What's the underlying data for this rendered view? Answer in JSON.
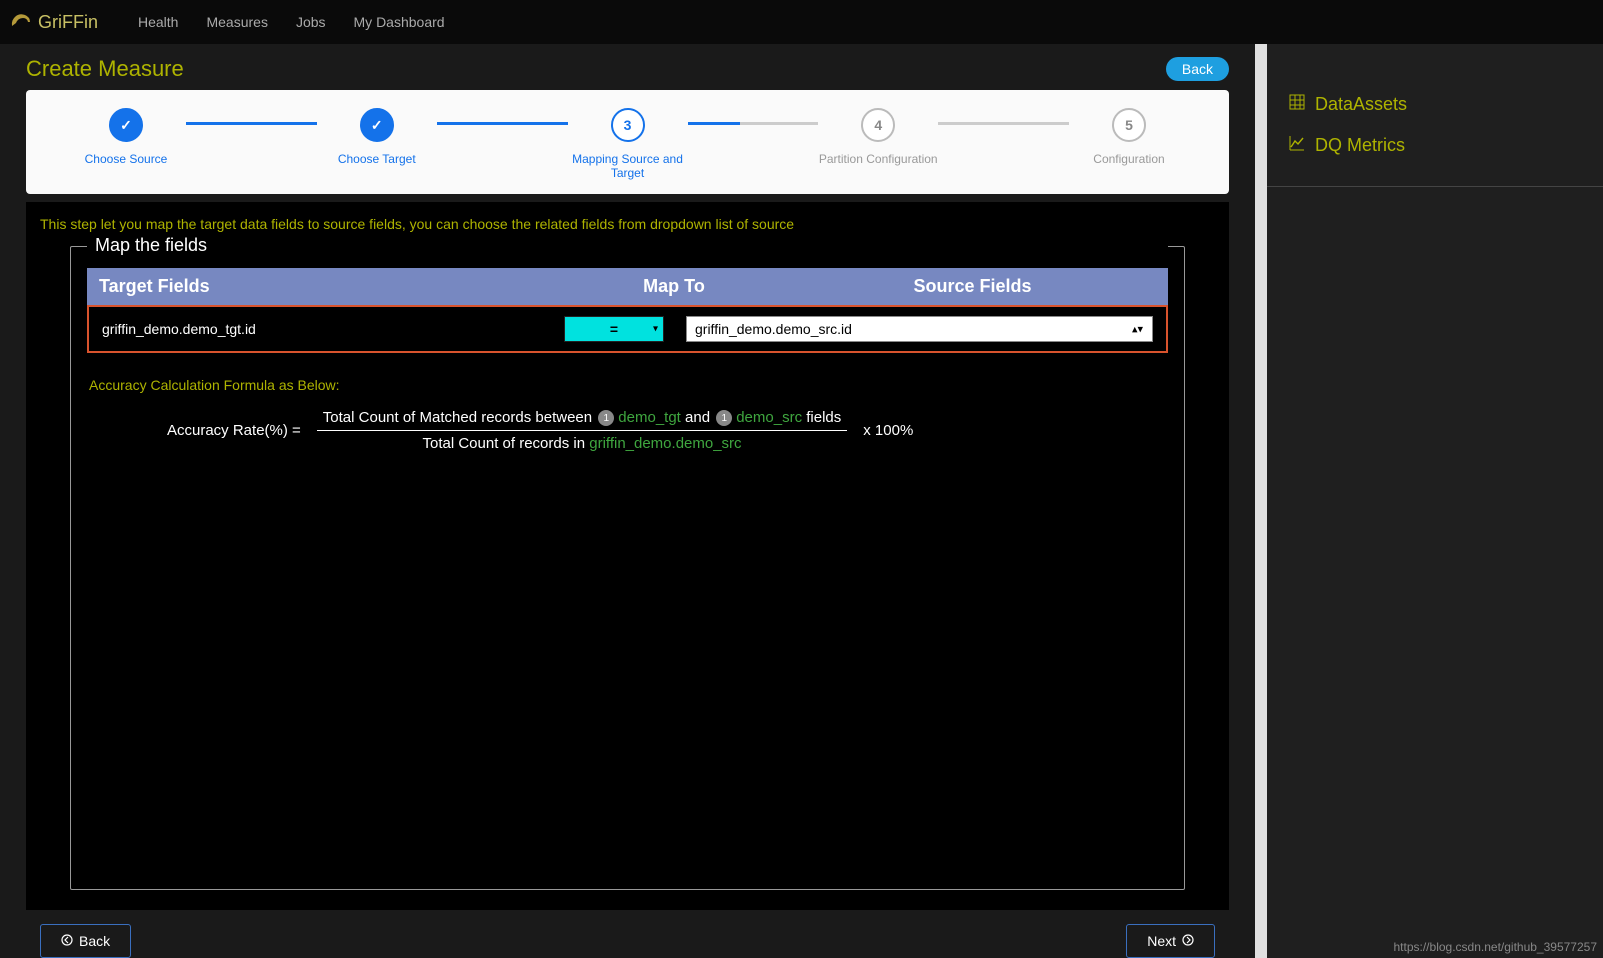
{
  "nav": {
    "brand": "GriFFin",
    "links": [
      "Health",
      "Measures",
      "Jobs",
      "My Dashboard"
    ]
  },
  "page": {
    "title": "Create Measure",
    "back": "Back"
  },
  "stepper": {
    "steps": [
      {
        "label": "Choose Source",
        "state": "done",
        "mark": "✓"
      },
      {
        "label": "Choose Target",
        "state": "done",
        "mark": "✓"
      },
      {
        "label": "Mapping Source and Target",
        "state": "active",
        "mark": "3"
      },
      {
        "label": "Partition Configuration",
        "state": "",
        "mark": "4"
      },
      {
        "label": "Configuration",
        "state": "",
        "mark": "5"
      }
    ]
  },
  "help": "This step let you map the target data fields to source fields, you can choose the related fields from dropdown list of source",
  "map": {
    "legend": "Map the fields",
    "headers": {
      "target": "Target Fields",
      "mapto": "Map To",
      "source": "Source Fields"
    },
    "row": {
      "target": "griffin_demo.demo_tgt.id",
      "op": "=",
      "source": "griffin_demo.demo_src.id"
    }
  },
  "formula": {
    "title": "Accuracy Calculation Formula as Below:",
    "lhs": "Accuracy Rate(%) =",
    "num_pre": "Total Count of Matched records between ",
    "num_tgt": "demo_tgt",
    "num_and": " and ",
    "num_src": "demo_src",
    "num_post": " fields",
    "den_pre": "Total Count of records in ",
    "den_src": "griffin_demo.demo_src",
    "x100": " x 100%",
    "badge": "1"
  },
  "buttons": {
    "back": "Back",
    "next": "Next"
  },
  "sidebar": {
    "items": [
      {
        "label": "DataAssets",
        "icon": "grid"
      },
      {
        "label": "DQ Metrics",
        "icon": "chart"
      }
    ]
  },
  "watermark": "https://blog.csdn.net/github_39577257"
}
